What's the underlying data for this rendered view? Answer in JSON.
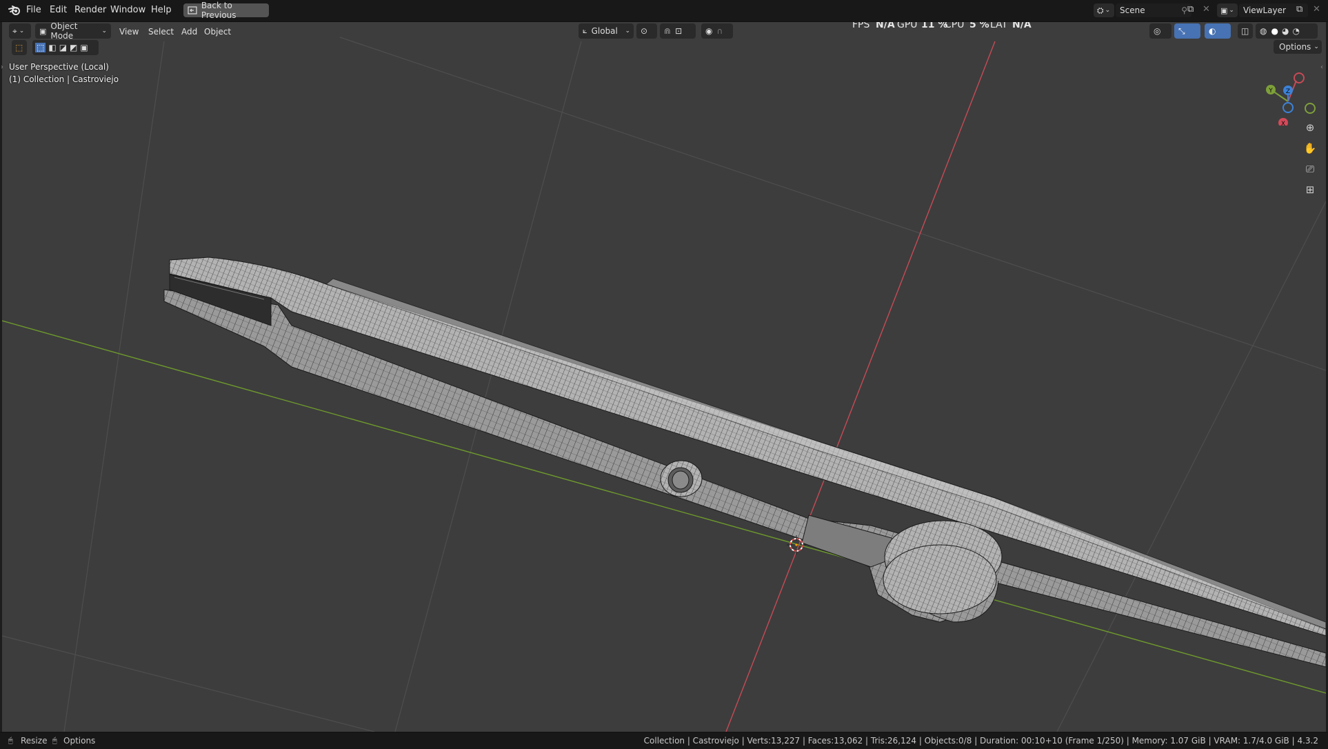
{
  "app": {
    "menus": [
      "File",
      "Edit",
      "Render",
      "Window",
      "Help"
    ],
    "back_button": "Back to Previous",
    "scene_label": "Scene",
    "viewlayer_label": "ViewLayer"
  },
  "stats": {
    "fps_label": "FPS",
    "fps_value": "N/A",
    "gpu_label": "GPU",
    "gpu_value": "11 %",
    "cpu_label": "CPU",
    "cpu_value": "5 %",
    "lat_label": "LAT",
    "lat_value": "N/A"
  },
  "header": {
    "mode": "Object Mode",
    "menus": [
      "View",
      "Select",
      "Add",
      "Object"
    ],
    "orientation": "Global",
    "options": "Options"
  },
  "viewport": {
    "perspective": "User Perspective (Local)",
    "collection": "(1) Collection | Castroviejo"
  },
  "gizmo": {
    "x": "X",
    "y": "Y",
    "z": "Z"
  },
  "status": {
    "left_action": "Resize",
    "left_options": "Options",
    "info": "Collection | Castroviejo | Verts:13,227 | Faces:13,062 | Tris:26,124 | Objects:0/8 | Duration: 00:10+10 (Frame 1/250) | Memory: 1.07 GiB | VRAM: 1.7/4.0 GiB | 4.3.2"
  },
  "colors": {
    "viewport_bg": "#3d3d3d",
    "x_axis": "#d44a5a",
    "y_axis": "#7ea03a",
    "z_axis": "#3c82d8",
    "accent": "#4772b3"
  },
  "icons": {
    "blender_logo": "blender-logo-icon",
    "editor_type": "viewport-editor-icon",
    "cursor": "3d-cursor-icon"
  }
}
